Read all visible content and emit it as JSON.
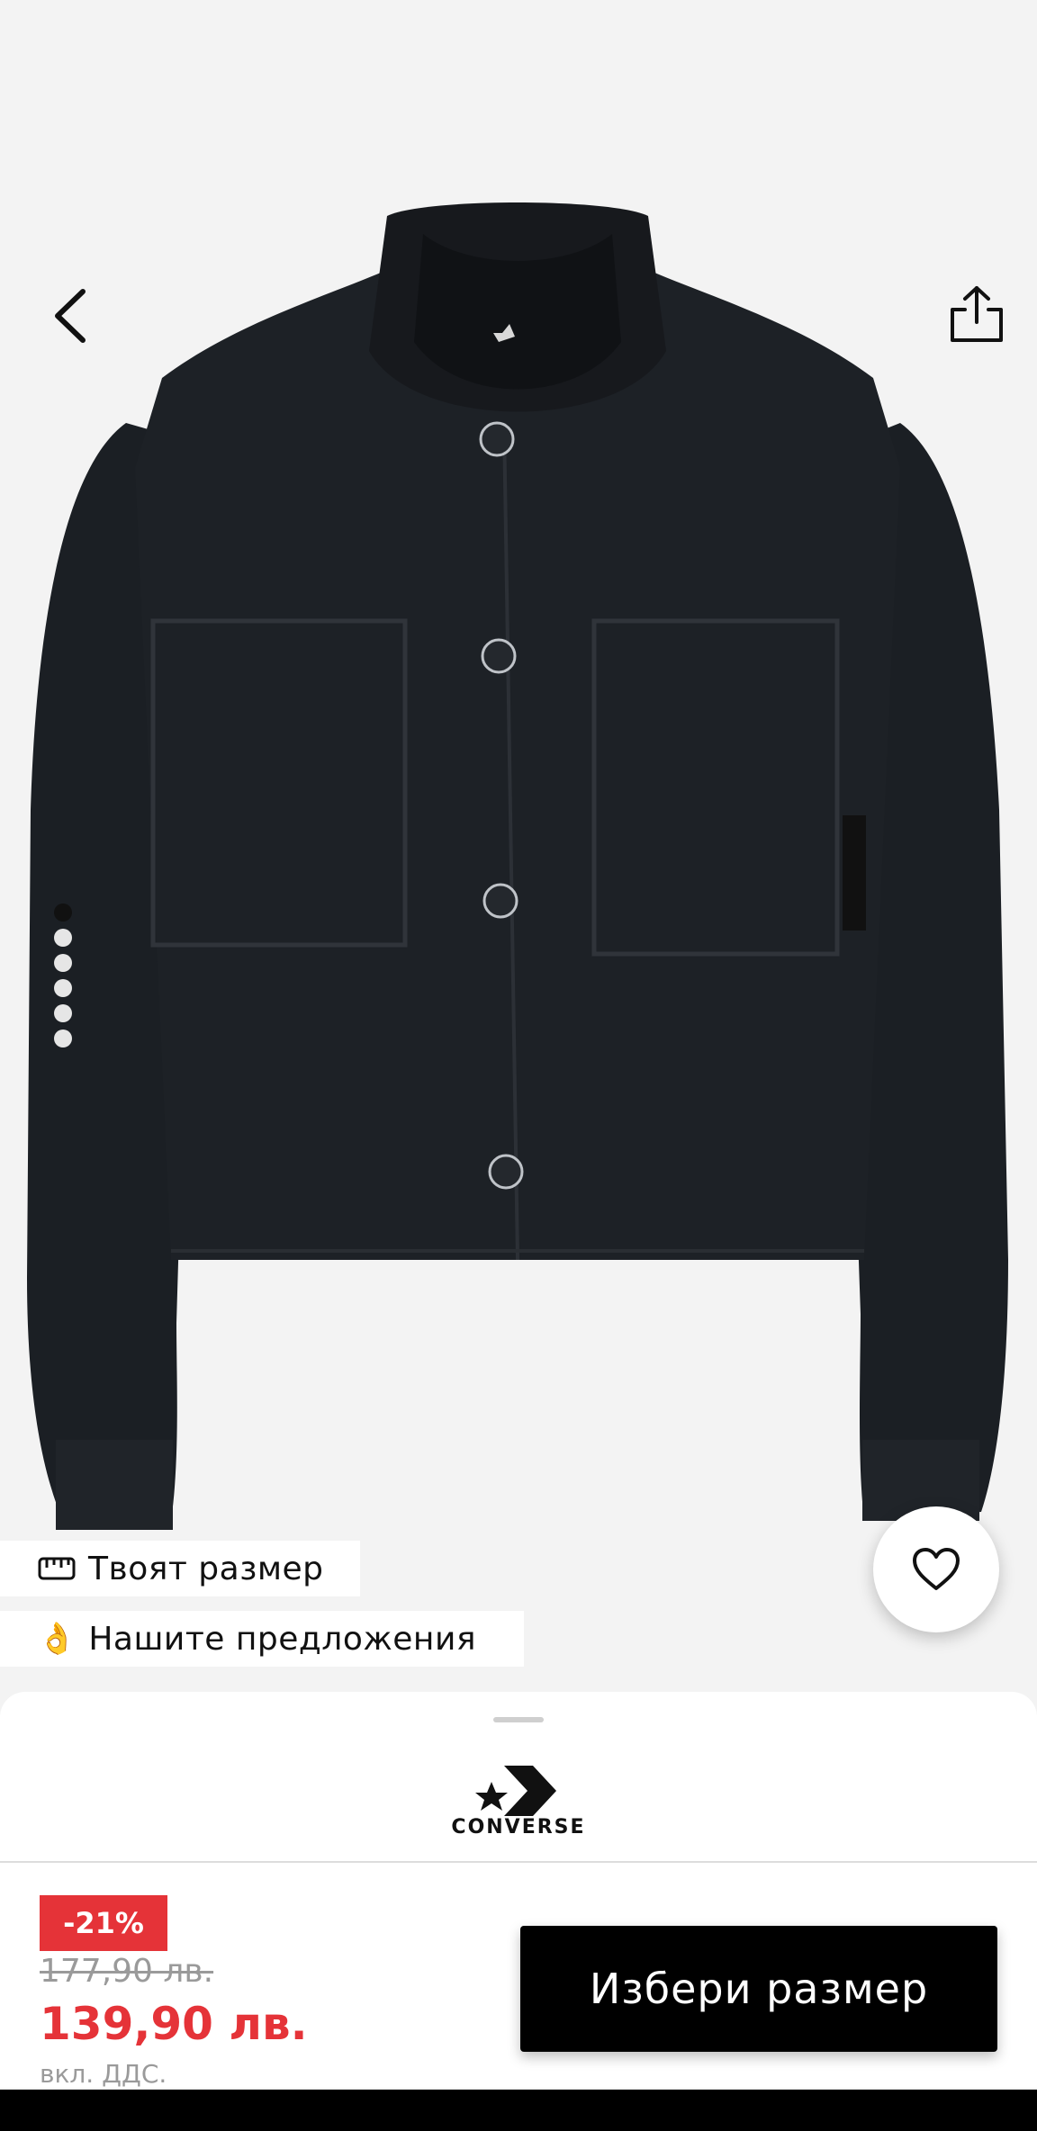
{
  "product_image": {
    "carousel_dots": 6,
    "active_index": 0,
    "garment_label": "CONVERSE"
  },
  "chips": {
    "size_label": "Твоят размер",
    "offers_label": "Нашите предложения",
    "offers_icon": "👌"
  },
  "brand": {
    "name": "CONVERSE"
  },
  "pricing": {
    "discount": "-21%",
    "old_price": "177,90 лв.",
    "new_price": "139,90 лв.",
    "vat_note": "вкл. ДДС.",
    "accent_color": "#e53338"
  },
  "cta": {
    "select_size_label": "Избери размер"
  },
  "icons": {
    "back": "chevron-left-icon",
    "share": "share-icon",
    "favorite": "heart-icon",
    "size": "measure-icon"
  }
}
